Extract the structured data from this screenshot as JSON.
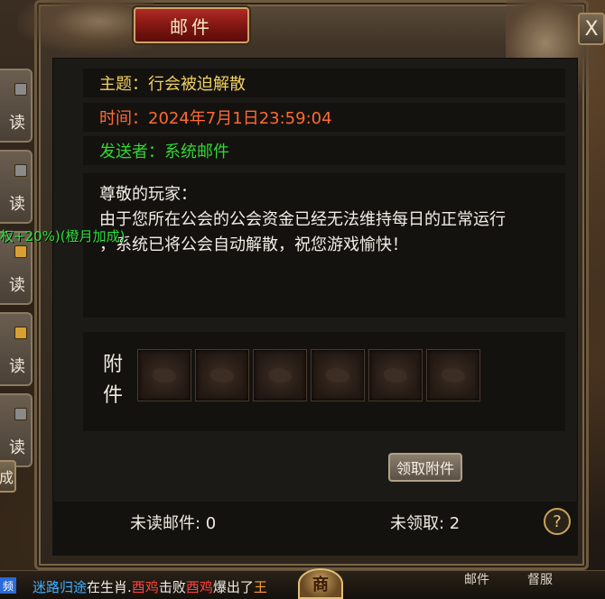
{
  "window": {
    "title": "邮件",
    "close_label": "X"
  },
  "mail_list": [
    {
      "status": "读",
      "icon": "mail-opened-icon"
    },
    {
      "status": "读",
      "icon": "mail-opened-icon"
    },
    {
      "status": "读",
      "icon": "gift-icon"
    },
    {
      "status": "读",
      "icon": "gift-icon"
    },
    {
      "status": "读",
      "icon": "mail-opened-icon"
    }
  ],
  "compose_label": "成",
  "overlay_bonus_text": "权+20%)(橙月加成)",
  "mail": {
    "subject": "主题：行会被迫解散",
    "time": "时间：2024年7月1日23:59:04",
    "sender": "发送者：系统邮件",
    "greeting": "尊敬的玩家：",
    "body_line1": "由于您所在公会的公会资金已经无法维持每日的正常运行",
    "body_line2": "，系统已将公会自动解散，祝您游戏愉快！"
  },
  "attachments": {
    "label_top": "附",
    "label_bottom": "件",
    "slot_count": 6
  },
  "claim_button_label": "领取附件",
  "footer": {
    "unread_label": "未读邮件: 0",
    "unclaimed_label": "未领取: 2",
    "help_label": "?"
  },
  "chat": {
    "tag": "频",
    "player1": "迷路归途",
    "text1": "在生肖.",
    "monster": "酉鸡",
    "text2": "击败",
    "monster2": "酉鸡",
    "text3": "爆出了",
    "item": "王"
  },
  "bottom_bar": {
    "shop_label": "商",
    "tab1": "邮件",
    "tab2": "督服"
  },
  "colors": {
    "subject": "#f0d060",
    "time": "#ff6a30",
    "sender": "#30d830",
    "title_plate": "#b02a24"
  }
}
